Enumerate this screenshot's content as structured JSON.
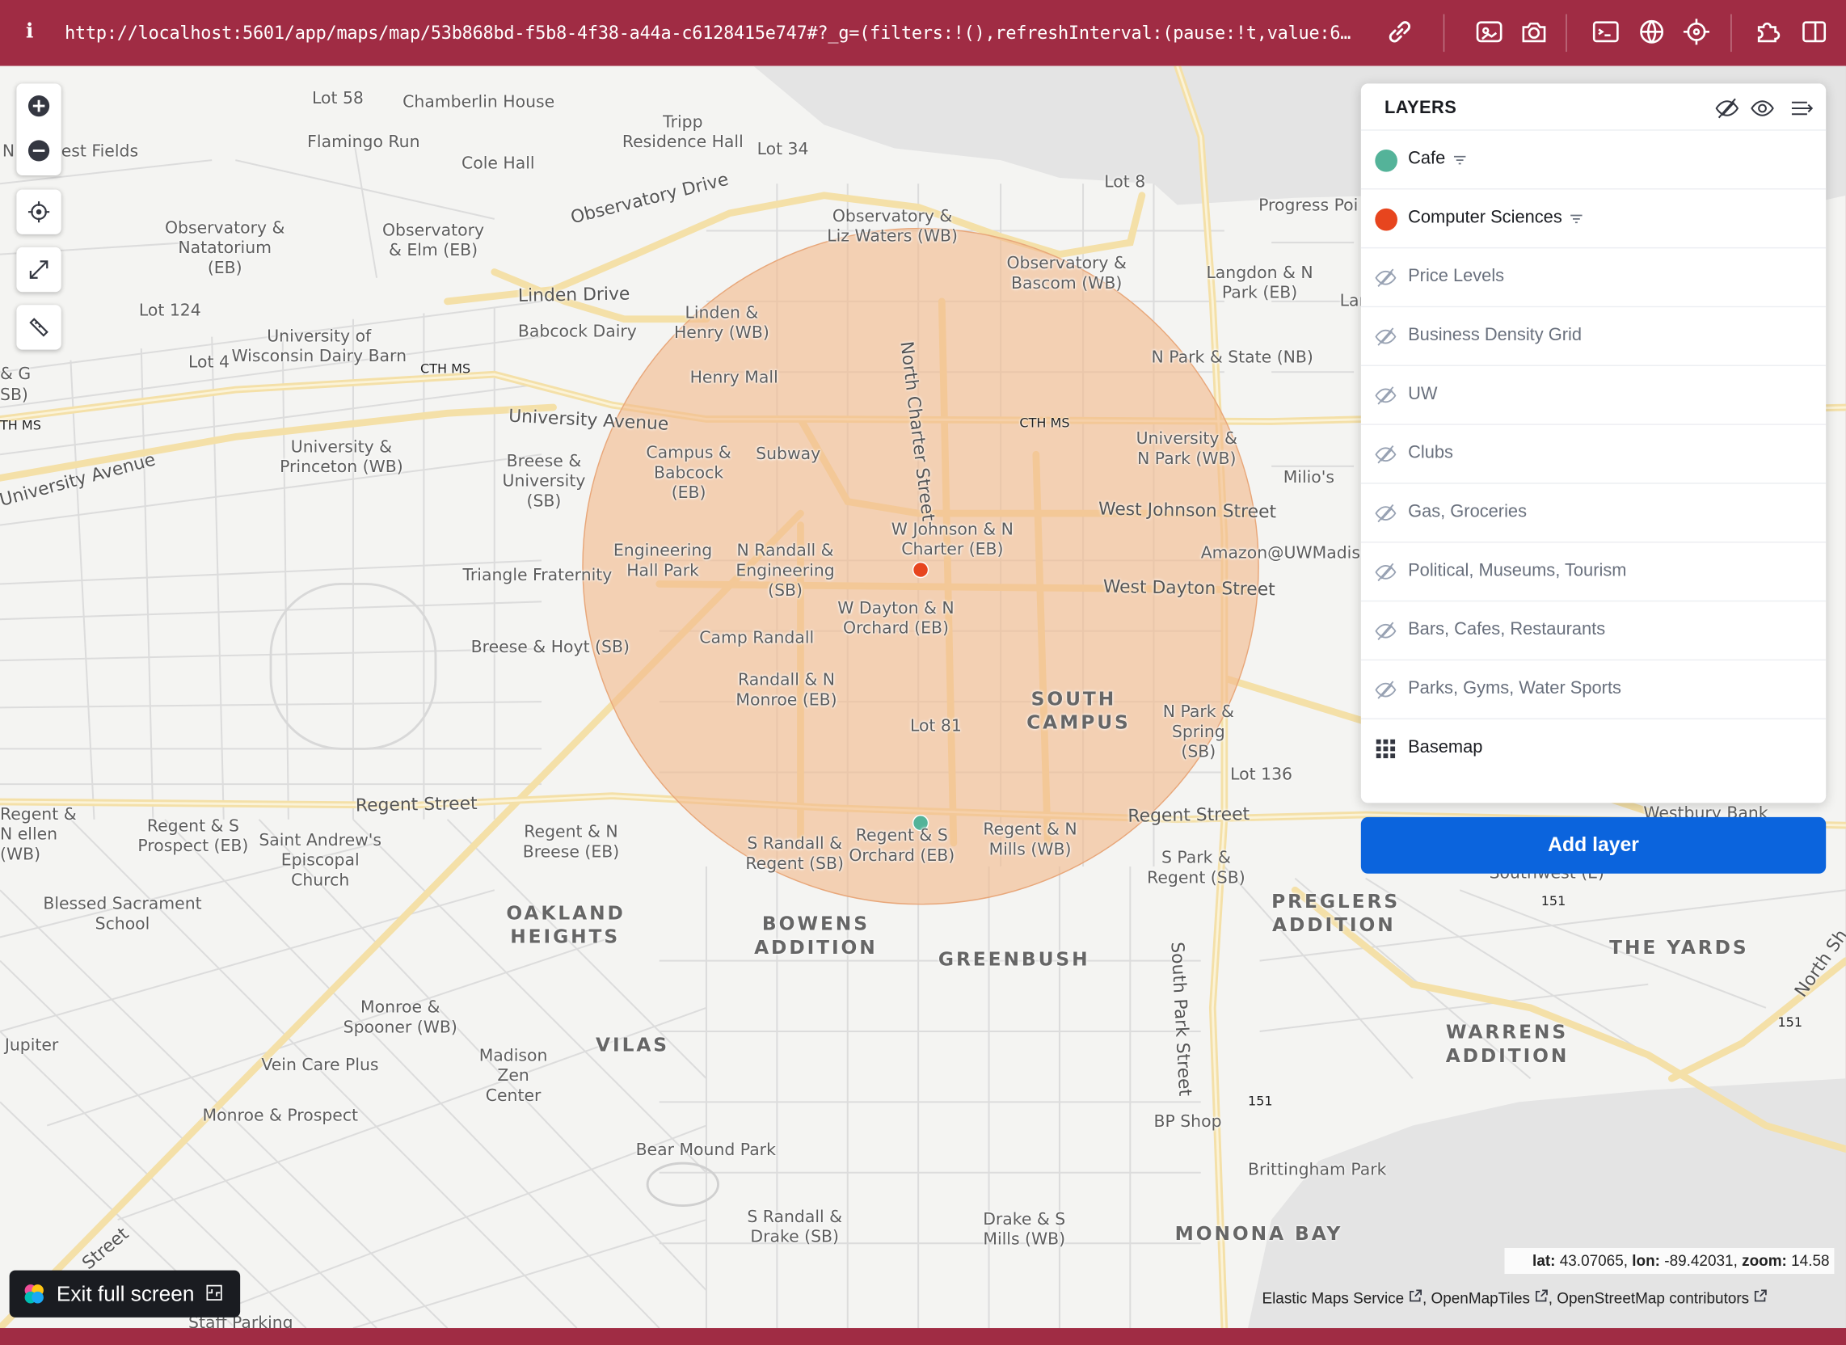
{
  "browser": {
    "url": "http://localhost:5601/app/maps/map/53b868bd-f5b8-4f38-a44a-c6128415e747#?_g=(filters:!(),refreshInterval:(pause:!t,value:6…",
    "icons": [
      "info-icon",
      "link-icon",
      "screenshot-icon",
      "camera-icon",
      "terminal-icon",
      "globe-icon",
      "crosshair-icon",
      "extensions-icon",
      "sidebar-icon"
    ]
  },
  "map_controls": [
    "zoom-in-icon",
    "zoom-out-icon",
    "locate-icon",
    "fit-bounds-icon",
    "measure-tool-icon"
  ],
  "layers_panel": {
    "title": "LAYERS",
    "header_icons": [
      "hide-all-icon",
      "show-all-icon",
      "collapse-panel-icon"
    ],
    "layers": [
      {
        "name": "Cafe",
        "visible": true,
        "color": "#54b399",
        "filtered": true
      },
      {
        "name": "Computer Sciences",
        "visible": true,
        "color": "#e7451e",
        "filtered": true
      },
      {
        "name": "Price Levels",
        "visible": false
      },
      {
        "name": "Business Density Grid",
        "visible": false
      },
      {
        "name": "UW",
        "visible": false
      },
      {
        "name": "Clubs",
        "visible": false
      },
      {
        "name": "Gas, Groceries",
        "visible": false
      },
      {
        "name": "Political, Museums, Tourism",
        "visible": false
      },
      {
        "name": "Bars, Cafes, Restaurants",
        "visible": false
      },
      {
        "name": "Parks, Gyms, Water Sports",
        "visible": false
      },
      {
        "name": "Basemap",
        "visible": true,
        "type": "tiles"
      }
    ],
    "add_layer": "Add layer"
  },
  "status": {
    "lat_label": "lat:",
    "lat": "43.07065",
    "lon_label": "lon:",
    "lon": "-89.42031",
    "zoom_label": "zoom:",
    "zoom": "14.58"
  },
  "attribution": [
    "Elastic Maps Service",
    "OpenMapTiles",
    "OpenStreetMap contributors"
  ],
  "exit_fullscreen": "Exit full screen",
  "colors": {
    "chrome": "#a02c44",
    "accent": "#0b64dd",
    "circle": "#f2b98d",
    "cafe": "#54b399",
    "cs": "#e7451e"
  },
  "map_labels": {
    "places": [
      "Lot 58",
      "Chamberlin House",
      "Tripp Residence Hall",
      "Flamingo Run",
      "Lot 34",
      "Cole Hall",
      "N",
      "est Fields",
      "Lot 8",
      "Progress Poi",
      "Observatory & Natatorium (EB)",
      "Observatory & Elm (EB)",
      "Observatory & Liz Waters (WB)",
      "Observatory & Bascom (WB)",
      "Langdon & N Park (EB)",
      "Lot 124",
      "University of Wisconsin Dairy Barn",
      "Lot 4",
      "Babcock Dairy",
      "Linden & Henry (WB)",
      "Henry Mall",
      "N Park & State (NB)",
      "University & Princeton (WB)",
      "Breese & University (SB)",
      "Campus & Babcock (EB)",
      "Subway",
      "University & N Park (WB)",
      "Milio's",
      "W Johnson & N Charter (EB)",
      "Engineering Hall Park",
      "N Randall & Engineering (SB)",
      "Triangle Fraternity",
      "Amazon@UWMadiso",
      "W Dayton & N Orchard (EB)",
      "Breese & Hoyt (SB)",
      "Camp Randall",
      "Randall & N Monroe (EB)",
      "Lot 81",
      "N Park & Spring (SB)",
      "Lot 136",
      "Regent & N ellen (WB)",
      "Regent & S Prospect (EB)",
      "Saint Andrew's Episcopal Church",
      "Regent & N Breese (EB)",
      "S Randall & Regent (SB)",
      "Regent & S Orchard (EB)",
      "Regent & N Mills (WB)",
      "S Park & Regent (SB)",
      "Blessed Sacrament School",
      "Monroe & Spooner (WB)",
      "Madison Zen Center",
      "Vein Care Plus",
      "Monroe & Prospect",
      "Jupiter",
      "Bear Mound Park",
      "BP Shop",
      "Brittingham Park",
      "S Randall & Drake (SB)",
      "Drake & S Mills (WB)",
      "Staff Parking",
      "Westbury Bank",
      "Southwest (E)",
      "Lar",
      "& G",
      "SB)"
    ],
    "neighborhoods": [
      "SOUTH CAMPUS",
      "OAKLAND HEIGHTS",
      "BOWENS ADDITION",
      "GREENBUSH",
      "VILAS",
      "PREGLERS ADDITION",
      "THE YARDS",
      "WARRENS ADDITION",
      "MONONA BAY"
    ],
    "roads": [
      "Observatory Drive",
      "Linden Drive",
      "University Avenue",
      "University Avenue",
      "North Charter Street",
      "West Johnson Street",
      "West Dayton Street",
      "Regent Street",
      "Regent Street",
      "South Park Street",
      "North Sh",
      "Street"
    ],
    "shields": [
      "CTH MS",
      "CTH MS",
      "TH MS",
      "151",
      "151",
      "151"
    ]
  }
}
